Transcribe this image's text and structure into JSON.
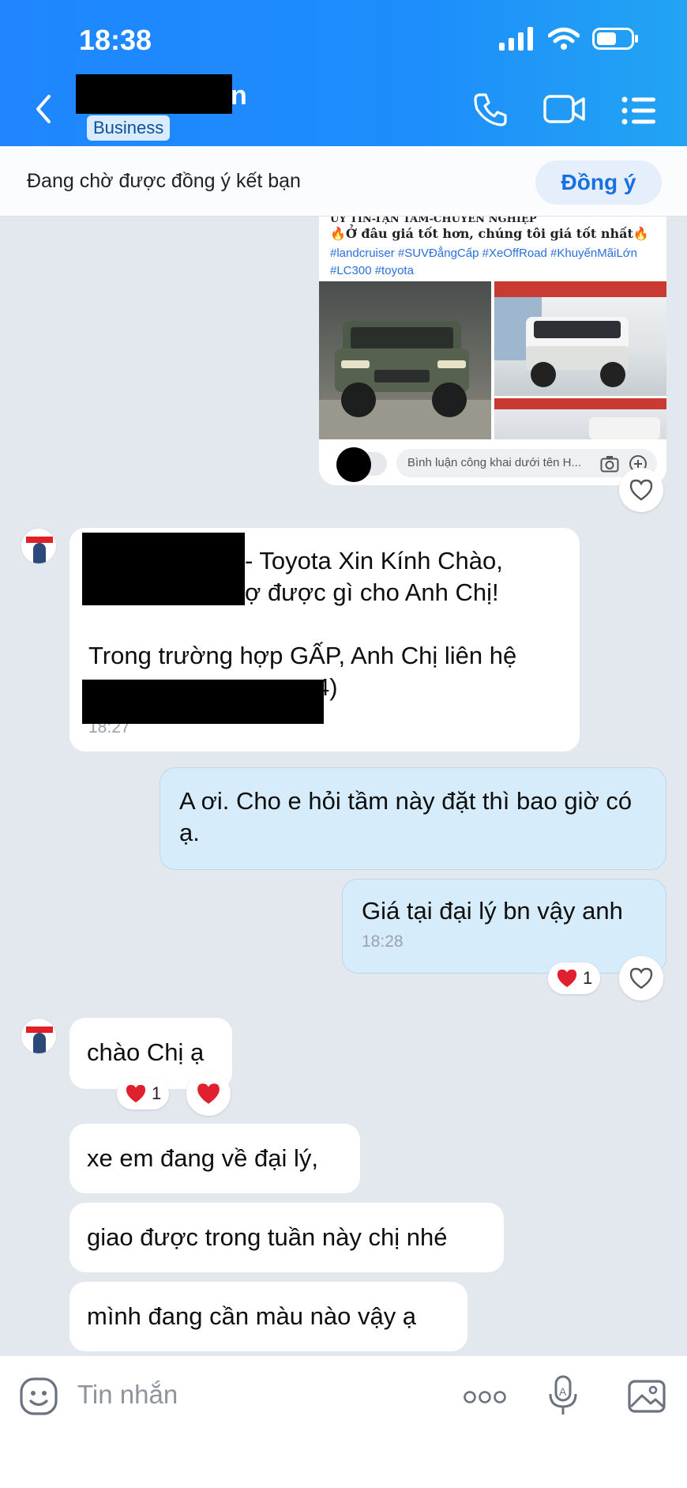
{
  "status": {
    "time": "18:38"
  },
  "header": {
    "name_suffix": "n",
    "badge": "Business"
  },
  "friend_request": {
    "text": "Đang chờ được đồng ý kết bạn",
    "accept_label": "Đồng ý"
  },
  "post": {
    "title": "UY TÍN-TẬN TÂM-CHUYÊN NGHIỆP",
    "subtitle": "Ở đâu giá tốt hơn, chúng tôi giá tốt nhất",
    "hashtags": "#landcruiser #SUVĐẳngCấp #XeOffRoad #KhuyếnMãiLớn #LC300 #toyota",
    "comment_placeholder": "Bình luận công khai dưới tên H..."
  },
  "messages": {
    "m1": {
      "line1": "- Toyota  Xin Kính Chào,",
      "line2": "ợ được gì cho Anh Chị!",
      "line3": "Trong trường hợp GẤP, Anh Chị liên hệ",
      "line4": "4)",
      "time": "18:27"
    },
    "m2": {
      "text": "A ơi. Cho e hỏi tầm này đặt thì bao giờ có ạ."
    },
    "m3": {
      "text": "Giá tại đại lý bn vậy anh",
      "time": "18:28",
      "reaction_count": "1"
    },
    "m4": {
      "text": "chào Chị ạ",
      "reaction_count": "1"
    },
    "m5": {
      "text": "xe em đang về đại lý,"
    },
    "m6": {
      "text": "giao được trong tuần này chị nhé"
    },
    "m7": {
      "text": "mình đang cần màu nào vậy ạ"
    }
  },
  "composer": {
    "placeholder": "Tin nhắn"
  },
  "colors": {
    "header": "#1f86ff",
    "outgoing_bubble": "#d7ecfb",
    "heart": "#e0202e",
    "accent": "#1a6fe0"
  }
}
